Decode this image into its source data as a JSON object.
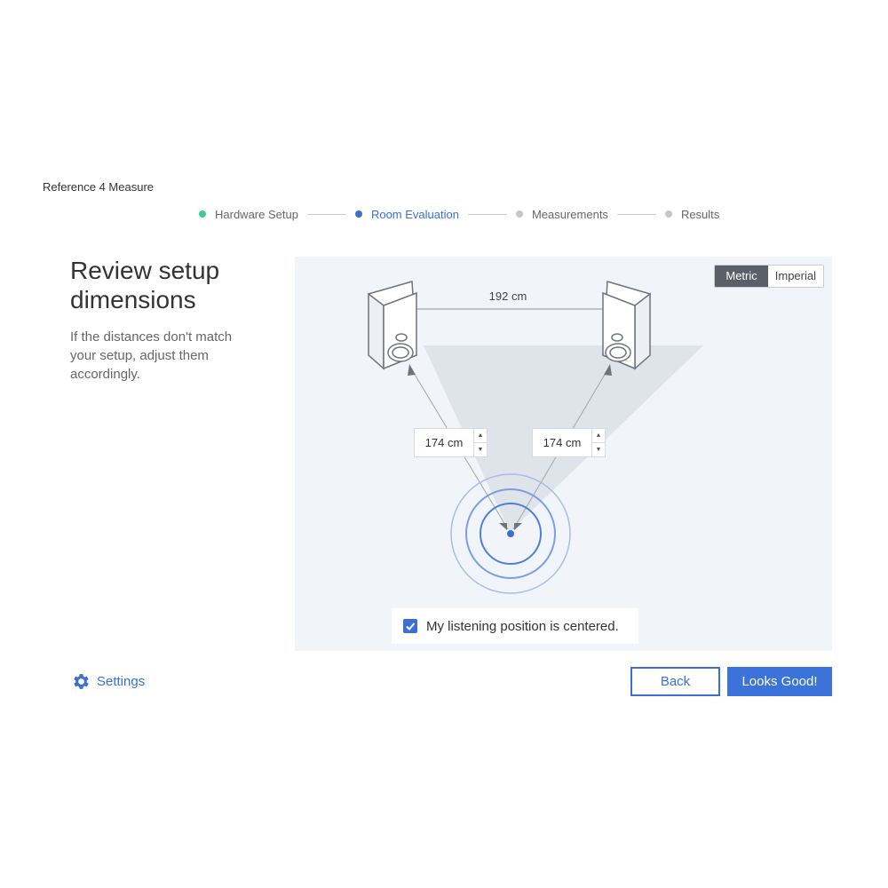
{
  "app": {
    "title": "Reference 4 Measure"
  },
  "stepper": {
    "steps": [
      {
        "label": "Hardware Setup",
        "state": "done"
      },
      {
        "label": "Room Evaluation",
        "state": "active"
      },
      {
        "label": "Measurements",
        "state": "pending"
      },
      {
        "label": "Results",
        "state": "pending"
      }
    ]
  },
  "main": {
    "title": "Review setup dimensions",
    "description": "If the distances don't match your setup, adjust them accordingly."
  },
  "diagram": {
    "units": {
      "metric_label": "Metric",
      "imperial_label": "Imperial",
      "selected": "Metric"
    },
    "speaker_distance": "192 cm",
    "left_distance": "174 cm",
    "right_distance": "174 cm",
    "centered_checkbox": {
      "label": "My listening position is centered.",
      "checked": true
    }
  },
  "footer": {
    "settings_label": "Settings",
    "back_label": "Back",
    "confirm_label": "Looks Good!"
  },
  "colors": {
    "accent": "#3b6fd6",
    "done": "#3ecb8f",
    "panel_bg": "#f1f4f9"
  }
}
